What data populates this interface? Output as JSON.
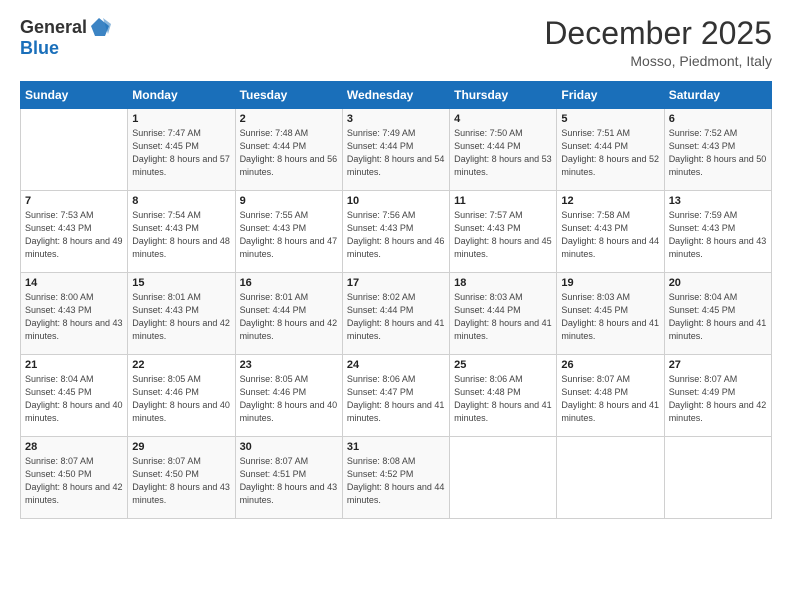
{
  "header": {
    "logo_general": "General",
    "logo_blue": "Blue",
    "title": "December 2025",
    "location": "Mosso, Piedmont, Italy"
  },
  "weekdays": [
    "Sunday",
    "Monday",
    "Tuesday",
    "Wednesday",
    "Thursday",
    "Friday",
    "Saturday"
  ],
  "weeks": [
    [
      {
        "day": "",
        "sunrise": "",
        "sunset": "",
        "daylight": "",
        "empty": true
      },
      {
        "day": "1",
        "sunrise": "7:47 AM",
        "sunset": "4:45 PM",
        "daylight": "8 hours and 57 minutes."
      },
      {
        "day": "2",
        "sunrise": "7:48 AM",
        "sunset": "4:44 PM",
        "daylight": "8 hours and 56 minutes."
      },
      {
        "day": "3",
        "sunrise": "7:49 AM",
        "sunset": "4:44 PM",
        "daylight": "8 hours and 54 minutes."
      },
      {
        "day": "4",
        "sunrise": "7:50 AM",
        "sunset": "4:44 PM",
        "daylight": "8 hours and 53 minutes."
      },
      {
        "day": "5",
        "sunrise": "7:51 AM",
        "sunset": "4:44 PM",
        "daylight": "8 hours and 52 minutes."
      },
      {
        "day": "6",
        "sunrise": "7:52 AM",
        "sunset": "4:43 PM",
        "daylight": "8 hours and 50 minutes."
      }
    ],
    [
      {
        "day": "7",
        "sunrise": "7:53 AM",
        "sunset": "4:43 PM",
        "daylight": "8 hours and 49 minutes."
      },
      {
        "day": "8",
        "sunrise": "7:54 AM",
        "sunset": "4:43 PM",
        "daylight": "8 hours and 48 minutes."
      },
      {
        "day": "9",
        "sunrise": "7:55 AM",
        "sunset": "4:43 PM",
        "daylight": "8 hours and 47 minutes."
      },
      {
        "day": "10",
        "sunrise": "7:56 AM",
        "sunset": "4:43 PM",
        "daylight": "8 hours and 46 minutes."
      },
      {
        "day": "11",
        "sunrise": "7:57 AM",
        "sunset": "4:43 PM",
        "daylight": "8 hours and 45 minutes."
      },
      {
        "day": "12",
        "sunrise": "7:58 AM",
        "sunset": "4:43 PM",
        "daylight": "8 hours and 44 minutes."
      },
      {
        "day": "13",
        "sunrise": "7:59 AM",
        "sunset": "4:43 PM",
        "daylight": "8 hours and 43 minutes."
      }
    ],
    [
      {
        "day": "14",
        "sunrise": "8:00 AM",
        "sunset": "4:43 PM",
        "daylight": "8 hours and 43 minutes."
      },
      {
        "day": "15",
        "sunrise": "8:01 AM",
        "sunset": "4:43 PM",
        "daylight": "8 hours and 42 minutes."
      },
      {
        "day": "16",
        "sunrise": "8:01 AM",
        "sunset": "4:44 PM",
        "daylight": "8 hours and 42 minutes."
      },
      {
        "day": "17",
        "sunrise": "8:02 AM",
        "sunset": "4:44 PM",
        "daylight": "8 hours and 41 minutes."
      },
      {
        "day": "18",
        "sunrise": "8:03 AM",
        "sunset": "4:44 PM",
        "daylight": "8 hours and 41 minutes."
      },
      {
        "day": "19",
        "sunrise": "8:03 AM",
        "sunset": "4:45 PM",
        "daylight": "8 hours and 41 minutes."
      },
      {
        "day": "20",
        "sunrise": "8:04 AM",
        "sunset": "4:45 PM",
        "daylight": "8 hours and 41 minutes."
      }
    ],
    [
      {
        "day": "21",
        "sunrise": "8:04 AM",
        "sunset": "4:45 PM",
        "daylight": "8 hours and 40 minutes."
      },
      {
        "day": "22",
        "sunrise": "8:05 AM",
        "sunset": "4:46 PM",
        "daylight": "8 hours and 40 minutes."
      },
      {
        "day": "23",
        "sunrise": "8:05 AM",
        "sunset": "4:46 PM",
        "daylight": "8 hours and 40 minutes."
      },
      {
        "day": "24",
        "sunrise": "8:06 AM",
        "sunset": "4:47 PM",
        "daylight": "8 hours and 41 minutes."
      },
      {
        "day": "25",
        "sunrise": "8:06 AM",
        "sunset": "4:48 PM",
        "daylight": "8 hours and 41 minutes."
      },
      {
        "day": "26",
        "sunrise": "8:07 AM",
        "sunset": "4:48 PM",
        "daylight": "8 hours and 41 minutes."
      },
      {
        "day": "27",
        "sunrise": "8:07 AM",
        "sunset": "4:49 PM",
        "daylight": "8 hours and 42 minutes."
      }
    ],
    [
      {
        "day": "28",
        "sunrise": "8:07 AM",
        "sunset": "4:50 PM",
        "daylight": "8 hours and 42 minutes."
      },
      {
        "day": "29",
        "sunrise": "8:07 AM",
        "sunset": "4:50 PM",
        "daylight": "8 hours and 43 minutes."
      },
      {
        "day": "30",
        "sunrise": "8:07 AM",
        "sunset": "4:51 PM",
        "daylight": "8 hours and 43 minutes."
      },
      {
        "day": "31",
        "sunrise": "8:08 AM",
        "sunset": "4:52 PM",
        "daylight": "8 hours and 44 minutes."
      },
      {
        "day": "",
        "sunrise": "",
        "sunset": "",
        "daylight": "",
        "empty": true
      },
      {
        "day": "",
        "sunrise": "",
        "sunset": "",
        "daylight": "",
        "empty": true
      },
      {
        "day": "",
        "sunrise": "",
        "sunset": "",
        "daylight": "",
        "empty": true
      }
    ]
  ]
}
